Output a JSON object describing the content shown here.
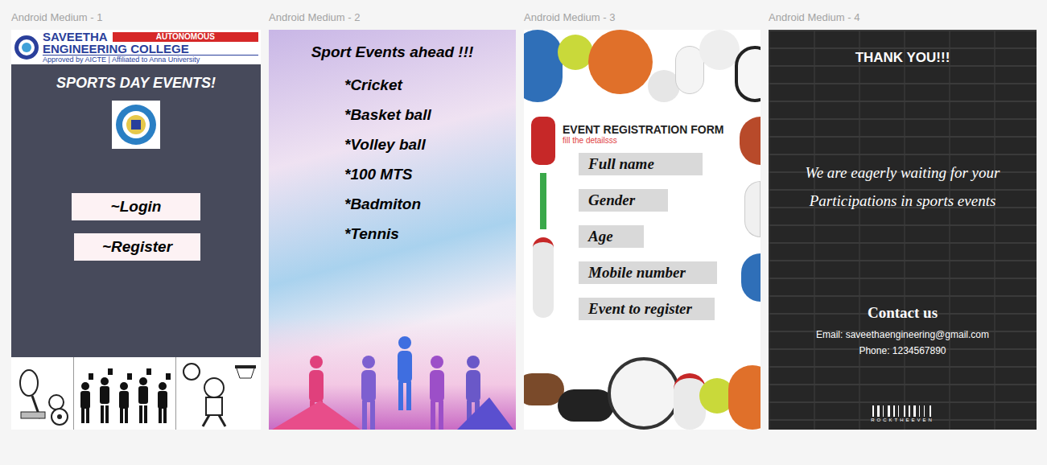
{
  "frame_labels": [
    "Android Medium - 1",
    "Android Medium - 2",
    "Android Medium - 3",
    "Android Medium - 4"
  ],
  "screen1": {
    "college_name": "SAVEETHA",
    "badge": "AUTONOMOUS",
    "college_subname": "ENGINEERING COLLEGE",
    "affiliation": "Approved by AICTE | Affiliated to Anna University",
    "title": "SPORTS DAY EVENTS!",
    "buttons": [
      "~Login",
      "~Register"
    ]
  },
  "screen2": {
    "title": "Sport Events ahead !!!",
    "events": [
      "*Cricket",
      "*Basket ball",
      "*Volley ball",
      "*100 MTS",
      "*Badmiton",
      "*Tennis"
    ]
  },
  "screen3": {
    "title": "EVENT REGISTRATION FORM",
    "subtitle": "fill the detailsss",
    "fields": [
      "Full name",
      "Gender",
      "Age",
      "Mobile number",
      "Event to register"
    ]
  },
  "screen4": {
    "title": "THANK YOU!!!",
    "message": [
      "We are eagerly waiting for your",
      "Participations in sports events"
    ],
    "contact_title": "Contact us",
    "email": "Email: saveethaengineering@gmail.com",
    "phone": "Phone: 1234567890",
    "barcode": "ROCKTHEEVEN"
  }
}
